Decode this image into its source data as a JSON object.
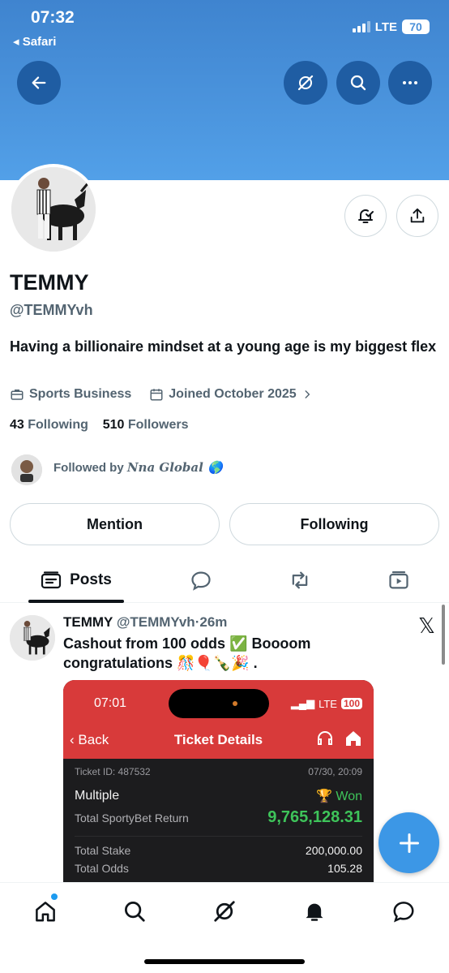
{
  "status_bar": {
    "time": "07:32",
    "back_app": "◂ Safari",
    "network": "LTE",
    "battery": "70"
  },
  "header": {
    "back_icon": "arrow-left-icon",
    "grok_icon": "grok-icon",
    "search_icon": "search-icon",
    "more_icon": "more-icon"
  },
  "profile": {
    "name": "TEMMY",
    "handle": "@TEMMYvh",
    "bio": "Having a billionaire mindset at a young age is my biggest flex",
    "category": "Sports Business",
    "joined": "Joined October 2025",
    "following_count": "43",
    "following_label": "Following",
    "followers_count": "510",
    "followers_label": "Followers",
    "followed_by_prefix": "Followed by",
    "followed_by_name": "Nna Global 🌎",
    "mention_label": "Mention",
    "following_button_label": "Following"
  },
  "tabs": [
    {
      "label": "Posts",
      "icon": "posts-icon",
      "active": true
    },
    {
      "label": "",
      "icon": "replies-icon",
      "active": false
    },
    {
      "label": "",
      "icon": "repost-icon",
      "active": false
    },
    {
      "label": "",
      "icon": "media-icon",
      "active": false
    }
  ],
  "post": {
    "author": "TEMMY",
    "handle": "@TEMMYvh",
    "dot": "·",
    "time": "26m",
    "text": "Cashout from 100 odds ✅ Boooom congratulations 🎊🎈🍾🎉 .",
    "embed": {
      "time": "07:01",
      "network": "LTE",
      "battery": "100",
      "back_label": "Back",
      "title": "Ticket Details",
      "ticket_id": "Ticket ID: 487532",
      "date": "07/30, 20:09",
      "bet_type": "Multiple",
      "status": "Won",
      "return_label": "Total SportyBet Return",
      "return_value": "9,765,128.31",
      "stake_label": "Total Stake",
      "stake_value": "200,000.00",
      "odds_label": "Total Odds",
      "odds_value": "105.28"
    }
  },
  "bottom_nav": [
    "home-icon",
    "search-icon",
    "grok-icon",
    "notifications-icon",
    "messages-icon"
  ],
  "colors": {
    "banner": "#4a93dc",
    "accent": "#1d9bf0",
    "embed_red": "#d83a3a",
    "won_green": "#3ec45a"
  }
}
